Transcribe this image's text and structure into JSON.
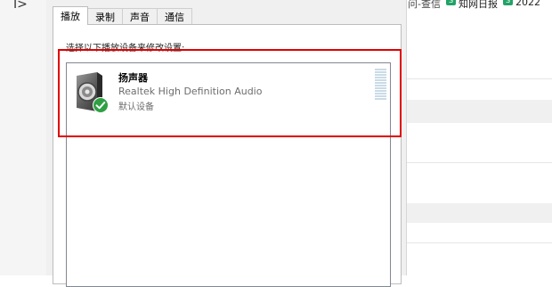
{
  "left_strip": {
    "glyph": "I>"
  },
  "dialog": {
    "tabs": [
      {
        "label": "播放",
        "active": true
      },
      {
        "label": "录制",
        "active": false
      },
      {
        "label": "声音",
        "active": false
      },
      {
        "label": "通信",
        "active": false
      }
    ],
    "instruction": "选择以下播放设备来修改设置:",
    "device": {
      "name": "扬声器",
      "description": "Realtek High Definition Audio",
      "status": "默认设备",
      "icon": "speaker-icon",
      "status_icon": "check-badge-icon",
      "check_color": "#2ea043"
    },
    "level_meter_level": 0
  },
  "background_app": {
    "clipped_text": "问-查信",
    "links": [
      {
        "label": "知网日报",
        "icon_letter": "S"
      },
      {
        "label": "2022",
        "icon_letter": "S"
      }
    ],
    "link_icon_color": "#21a366"
  },
  "annotation": {
    "color": "#e10000"
  }
}
